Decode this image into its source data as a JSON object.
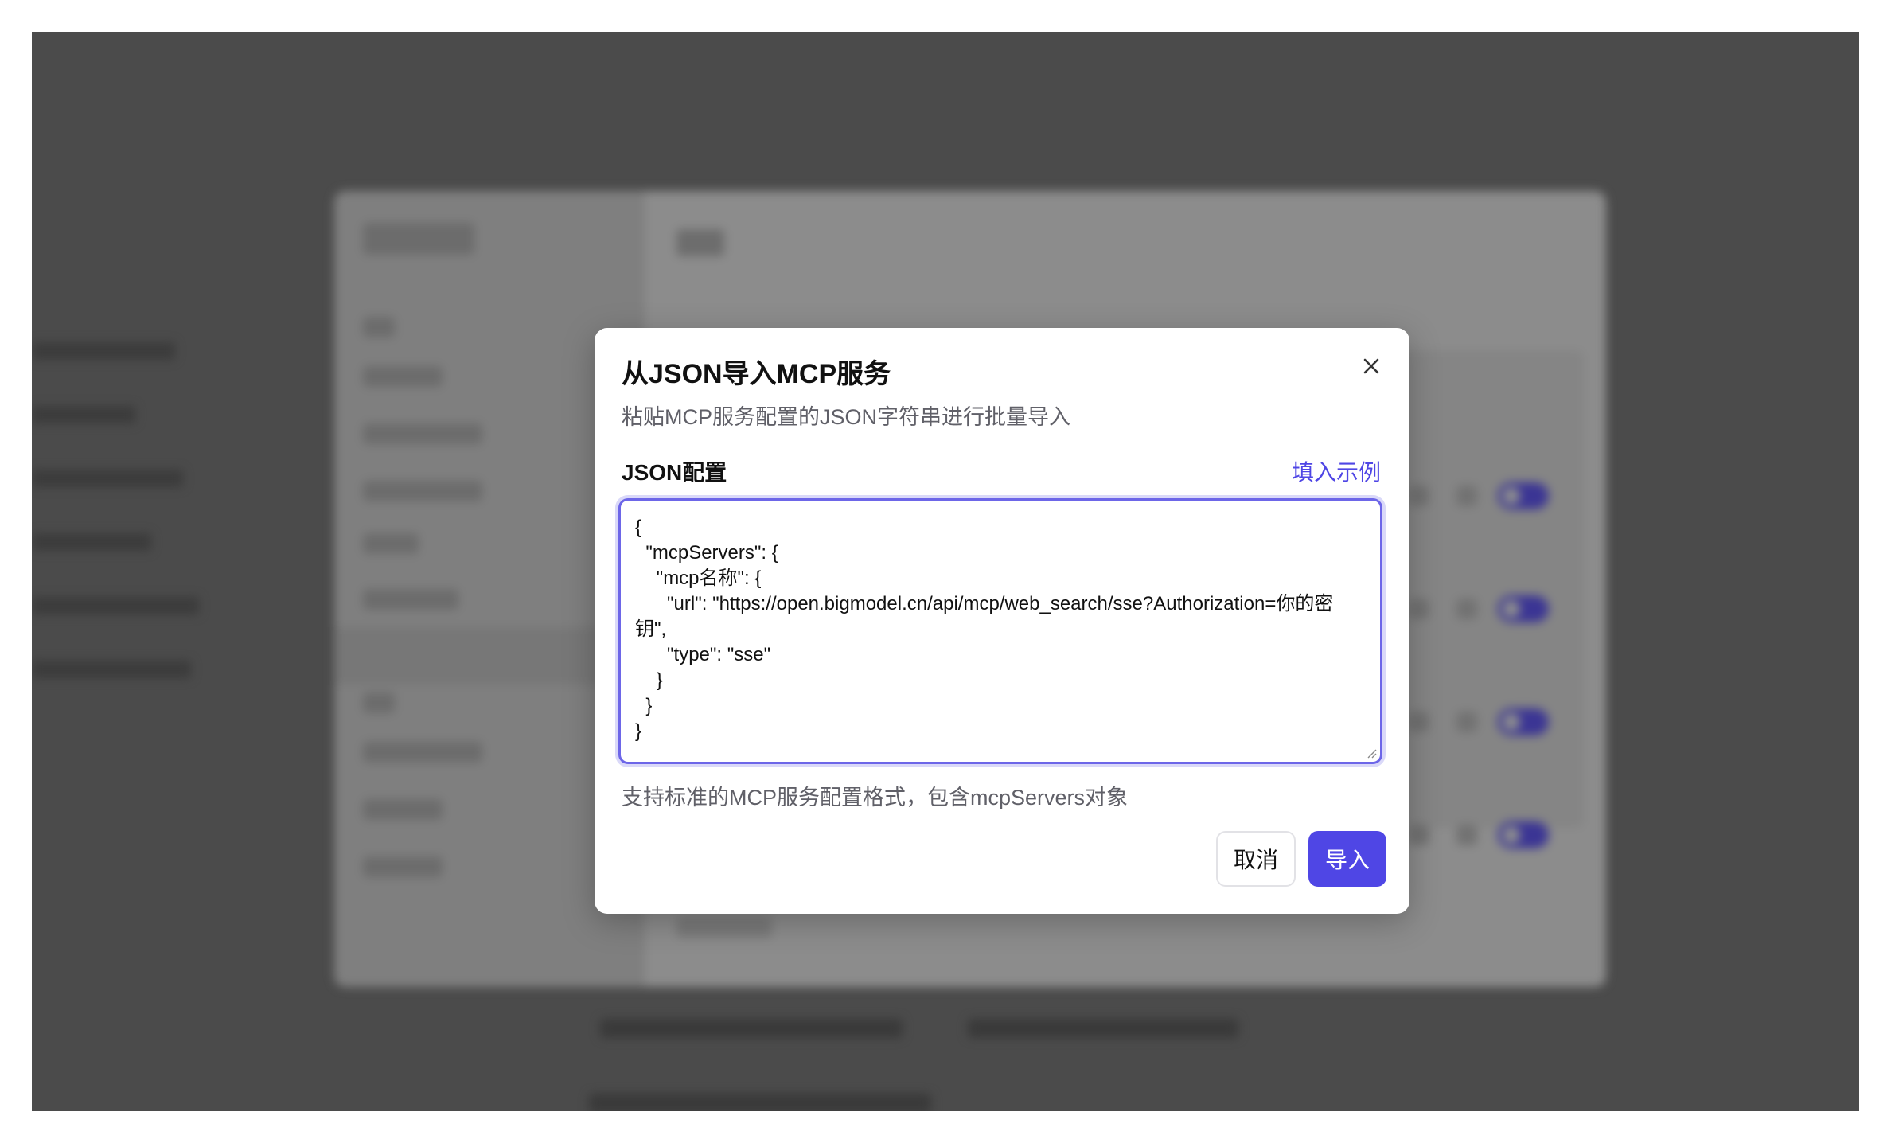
{
  "dialog": {
    "title": "从JSON导入MCP服务",
    "subtitle": "粘贴MCP服务配置的JSON字符串进行批量导入",
    "close_icon": "close-icon",
    "field_label": "JSON配置",
    "fill_example_label": "填入示例",
    "json_value": "{\n  \"mcpServers\": {\n    \"mcp名称\": {\n      \"url\": \"https://open.bigmodel.cn/api/mcp/web_search/sse?Authorization=你的密钥\",\n      \"type\": \"sse\"\n    }\n  }\n}",
    "hint": "支持标准的MCP服务配置格式，包含mcpServers对象",
    "cancel_label": "取消",
    "import_label": "导入"
  },
  "colors": {
    "accent": "#4f46e5",
    "overlay": "#4b4b4b",
    "focus_ring": "#6d66e8"
  }
}
